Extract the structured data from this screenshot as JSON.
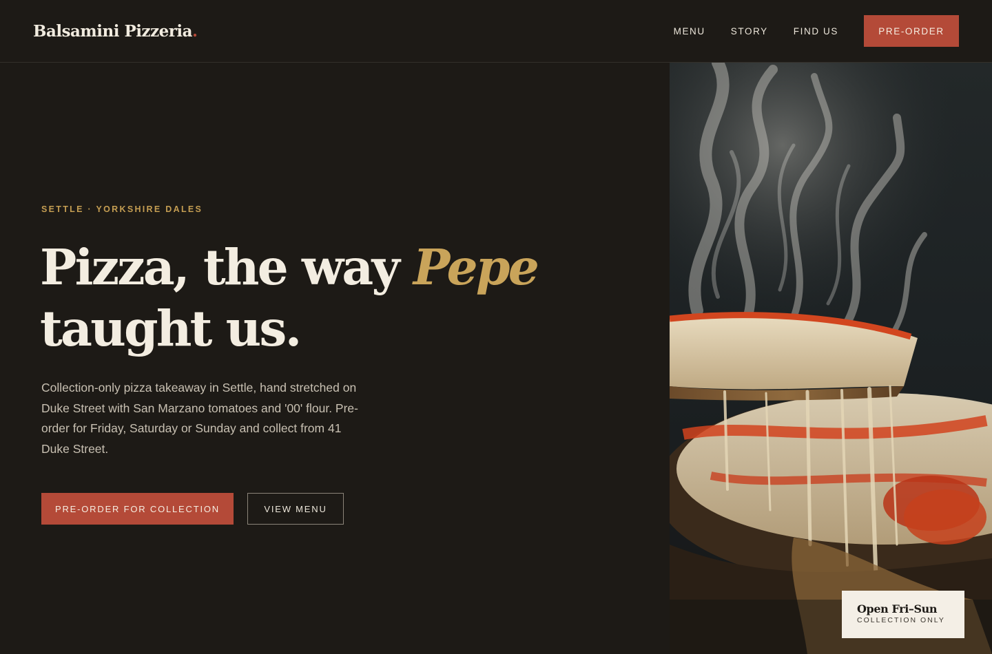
{
  "brand": {
    "name": "Balsamini Pizzeria",
    "dot": "."
  },
  "nav": {
    "items": [
      {
        "label": "MENU"
      },
      {
        "label": "STORY"
      },
      {
        "label": "FIND US"
      }
    ],
    "cta_label": "PRE-ORDER"
  },
  "hero": {
    "eyebrow": "SETTLE · YORKSHIRE DALES",
    "headline_before": "Pizza, the way ",
    "headline_accent": "Pepe",
    "headline_after": "taught us.",
    "lede": "Collection-only pizza takeaway in Settle, hand stretched on Duke Street with San Marzano tomatoes and '00' flour. Pre-order for Friday, Saturday or Sunday and collect from 41 Duke Street.",
    "primary_cta": "PRE-ORDER FOR COLLECTION",
    "secondary_cta": "VIEW MENU"
  },
  "photo": {
    "subject": "pizza-slice-cheese-pull-steam"
  },
  "badge": {
    "title": "Open Fri–Sun",
    "subtitle": "COLLECTION ONLY"
  },
  "colors": {
    "background": "#1d1a16",
    "accent_red": "#b44a38",
    "accent_gold": "#c9a45a",
    "text_light": "#f3ede1",
    "badge_bg": "#f4efe6"
  }
}
